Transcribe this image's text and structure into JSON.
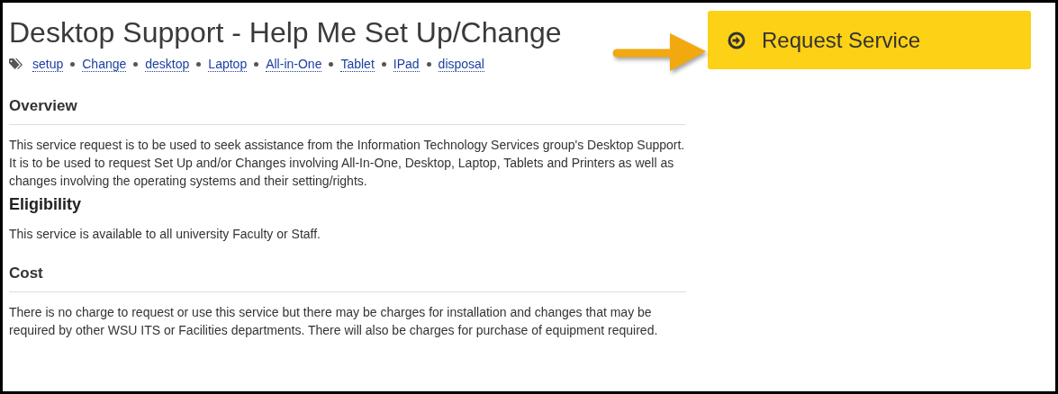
{
  "title": "Desktop Support - Help Me Set Up/Change",
  "tags": [
    "setup",
    "Change",
    "desktop",
    "Laptop",
    "All-in-One",
    "Tablet",
    "IPad",
    "disposal"
  ],
  "sections": [
    {
      "kind": "ruled",
      "heading": "Overview",
      "text": "This service request is to be used to seek assistance from the Information Technology Services group's Desktop Support. It is to be used to request Set Up and/or Changes involving All-In-One, Desktop, Laptop, Tablets and Printers as well as changes involving the operating systems and their setting/rights."
    },
    {
      "kind": "plain",
      "heading": "Eligibility",
      "text": "This service is available to all university Faculty or Staff."
    },
    {
      "kind": "ruled",
      "heading": "Cost",
      "text": "There is no charge to request or use this service but there may be charges for installation and changes that may be required by other WSU ITS or Facilities departments. There will also be charges for purchase of equipment required."
    }
  ],
  "button": {
    "label": "Request Service"
  }
}
